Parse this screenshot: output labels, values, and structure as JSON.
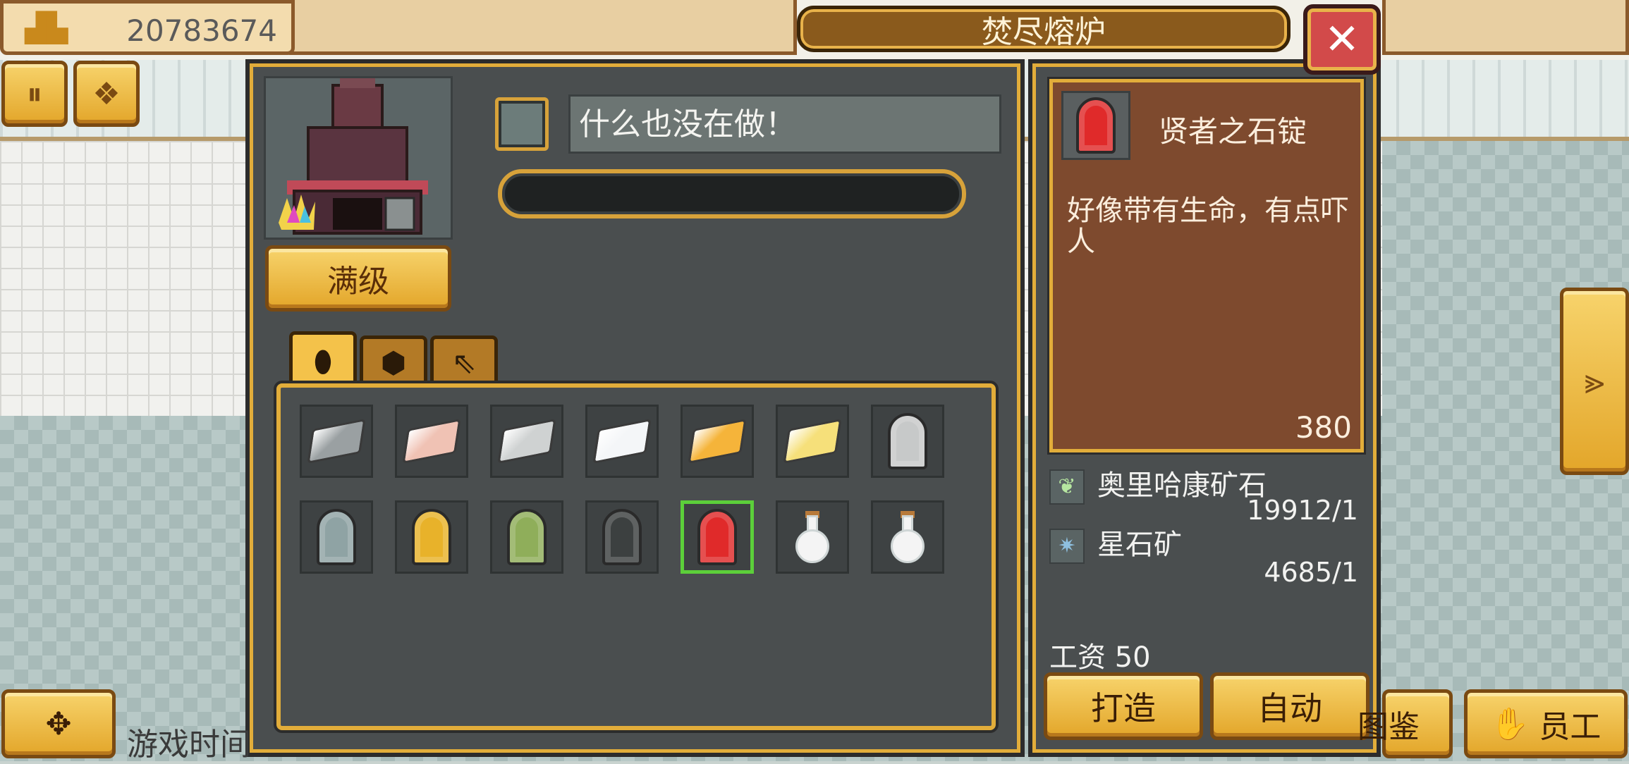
{
  "top": {
    "coins": "20783674",
    "coins_icon": "gold-stack-icon"
  },
  "quick_buttons": [
    {
      "icon": "pause-icon",
      "glyph": "⏸"
    },
    {
      "icon": "gems-icon",
      "glyph": "❖"
    }
  ],
  "window": {
    "title": "焚尽熔炉",
    "close_glyph": "✕"
  },
  "furnace": {
    "max_label": "满级"
  },
  "status": {
    "text": "什么也没在做！",
    "progress": 0
  },
  "tabs": [
    {
      "icon": "ingot-tab-icon",
      "glyph": "⬮",
      "active": true
    },
    {
      "icon": "gem-tab-icon",
      "glyph": "⬢",
      "active": false
    },
    {
      "icon": "pickaxe-tab-icon",
      "glyph": "⇖",
      "active": false
    }
  ],
  "items": [
    {
      "kind": "ingot",
      "color": "#9aa0a2"
    },
    {
      "kind": "ingot",
      "color": "#f0c2b4"
    },
    {
      "kind": "ingot",
      "color": "#cfd2d2"
    },
    {
      "kind": "ingot",
      "color": "#f4f6f8"
    },
    {
      "kind": "ingot",
      "color": "#f5b43a"
    },
    {
      "kind": "ingot",
      "color": "#f6e07a"
    },
    {
      "kind": "tomb",
      "color": "#c7c9c9"
    },
    {
      "kind": "tomb",
      "color": "#8fa3a4"
    },
    {
      "kind": "tomb",
      "color": "#e8b22a"
    },
    {
      "kind": "tomb",
      "color": "#8fae5a"
    },
    {
      "kind": "tomb",
      "color": "#3c4040"
    },
    {
      "kind": "tomb",
      "color": "#e02a2a",
      "selected": true
    },
    {
      "kind": "flask",
      "color": "#f4f4f4"
    },
    {
      "kind": "flask",
      "color": "#f4f4f4"
    }
  ],
  "detail": {
    "name": "贤者之石锭",
    "description": "好像带有生命，有点吓人",
    "value": "380",
    "icon_color": "#e02a2a"
  },
  "materials": [
    {
      "name": "奥里哈康矿石",
      "qty": "19912/1",
      "icon": "ore-icon"
    },
    {
      "name": "星石矿",
      "qty": "4685/1",
      "icon": "starstone-icon"
    }
  ],
  "wage": "工资 50",
  "actions": {
    "craft": "打造",
    "auto": "自动"
  },
  "side_arrow_glyph": "⪢",
  "bottom": {
    "compass_glyph": "✥",
    "game_time": "游戏时间",
    "codex": "图鉴",
    "staff": "员工",
    "staff_icon": "hand-icon"
  }
}
